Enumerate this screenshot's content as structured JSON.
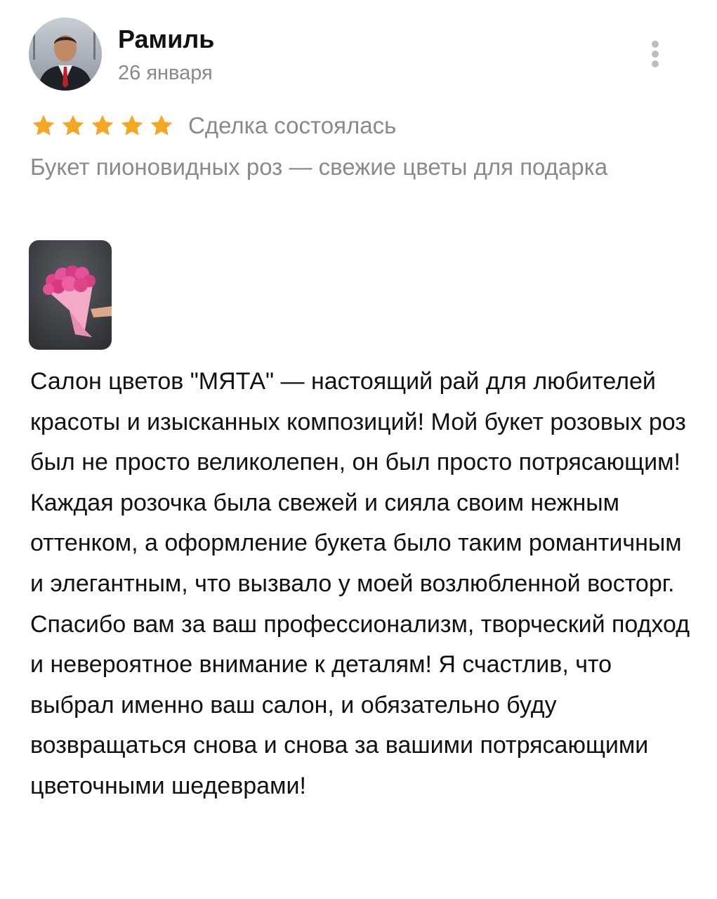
{
  "review": {
    "author": {
      "name": "Рамиль",
      "date": "26 января"
    },
    "rating": {
      "stars": 5,
      "max": 5,
      "star_color": "#f5a623"
    },
    "deal_status": "Сделка состоялась",
    "product_title": "Букет пионовидных роз — свежие цветы для подарка",
    "text": "Салон цветов \"МЯТА\" — настоящий рай для любителей красоты и изысканных композиций! Мой букет розовых роз был не просто великолепен, он был просто потрясающим! Каждая розочка была свежей и сияла своим нежным оттенком, а оформление букета было таким романтичным и элегантным, что вызвало у моей возлюбленной восторг. Спасибо вам за ваш профессионализм, творческий подход и невероятное внимание к деталям! Я счастлив, что выбрал именно ваш салон, и обязательно буду возвращаться снова и снова за вашими потрясающими цветочными шедеврами!",
    "icons": {
      "more": "vertical-dots-icon",
      "star": "star-icon"
    }
  }
}
